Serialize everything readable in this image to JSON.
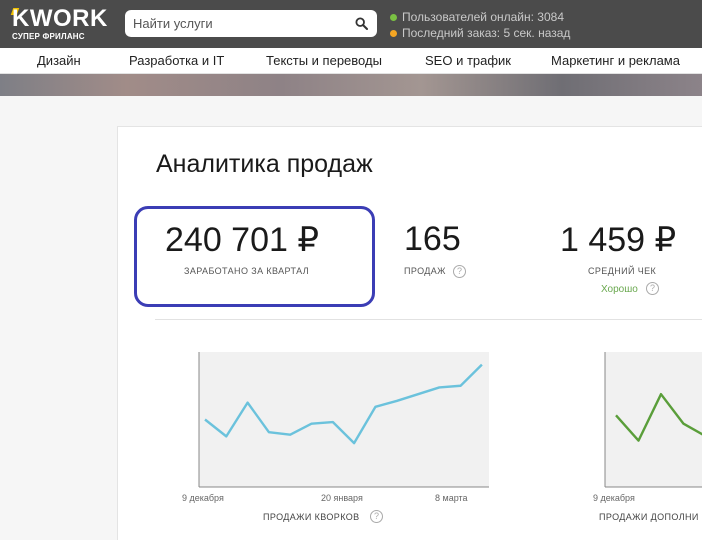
{
  "header": {
    "logo_text": "KWORK",
    "logo_subtitle": "СУПЕР ФРИЛАНС",
    "search_placeholder": "Найти услуги",
    "online_users": "Пользователей онлайн: 3084",
    "last_order": "Последний заказ: 5 сек. назад",
    "online_dot_color": "#7ac143",
    "order_dot_color": "#f5a623"
  },
  "nav": {
    "items": [
      "Дизайн",
      "Разработка и IT",
      "Тексты и переводы",
      "SEO и трафик",
      "Маркетинг и реклама"
    ]
  },
  "page": {
    "title": "Аналитика продаж"
  },
  "metrics": {
    "earned": {
      "value": "240 701 ₽",
      "label": "ЗАРАБОТАНО ЗА КВАРТАЛ"
    },
    "sales": {
      "value": "165",
      "label": "ПРОДАЖ",
      "help": "?"
    },
    "avg_check": {
      "value": "1 459 ₽",
      "label": "СРЕДНИЙ ЧЕК",
      "rating": "Хорошо",
      "help": "?"
    }
  },
  "chart_data": [
    {
      "type": "line",
      "title": "ПРОДАЖИ КВОРКОВ",
      "help": "?",
      "color": "#6bc2dc",
      "x_tick_labels": [
        "9 декабря",
        "20 января",
        "8 марта"
      ],
      "values": [
        8,
        6,
        10,
        6.5,
        6.2,
        7.5,
        7.7,
        5.2,
        9.5,
        10.2,
        11,
        11.8,
        12,
        14.5
      ],
      "ylim": [
        0,
        16
      ]
    },
    {
      "type": "line",
      "title": "ПРОДАЖИ ДОПОЛНИ",
      "color": "#5a9e3a",
      "x_tick_labels": [
        "9 декабря"
      ],
      "values": [
        8.5,
        5.5,
        11,
        7.5,
        6
      ],
      "ylim": [
        0,
        16
      ]
    }
  ]
}
